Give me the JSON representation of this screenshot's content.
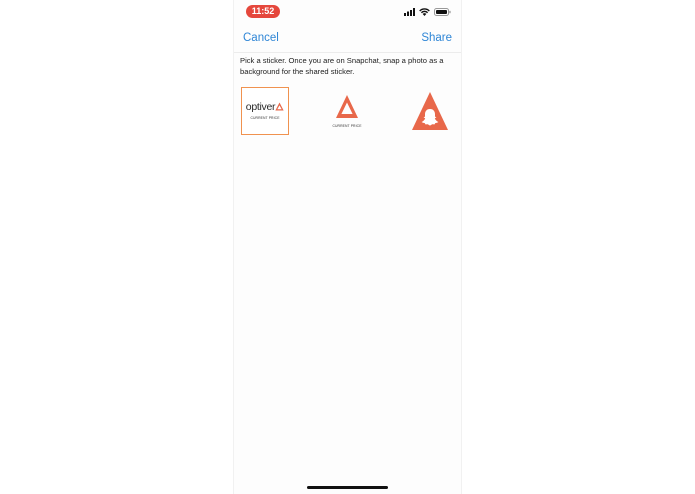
{
  "status_bar": {
    "time": "11:52",
    "icons": [
      "cellular-signal-icon",
      "wifi-icon",
      "battery-icon"
    ]
  },
  "nav": {
    "cancel_label": "Cancel",
    "share_label": "Share"
  },
  "instructions": "Pick a sticker. Once you are on Snapchat, snap a photo as a background for the shared sticker.",
  "stickers": [
    {
      "wordmark": "optiver",
      "sub_label": "CURRENT PRICE",
      "selected": true
    },
    {
      "sub_label": "CURRENT PRICE",
      "selected": false
    },
    {
      "icon": "snapchat-ghost-icon",
      "selected": false
    }
  ],
  "colors": {
    "accent_blue": "#2f86d6",
    "brand_orange": "#e8684a",
    "time_pill": "#e5473c",
    "selection_border": "#f0924f"
  }
}
